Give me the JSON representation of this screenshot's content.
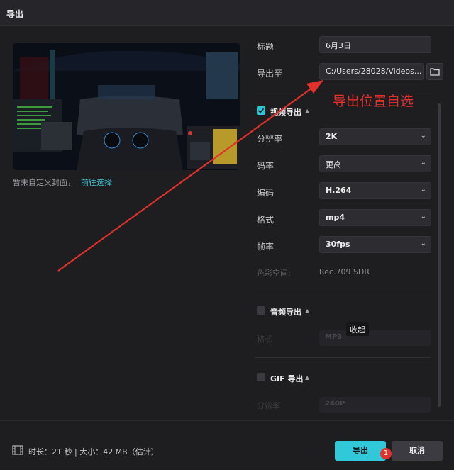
{
  "window": {
    "title": "导出"
  },
  "cover": {
    "note": "暂未自定义封面，",
    "link": "前往选择"
  },
  "fields": {
    "title_label": "标题",
    "title_value": "6月3日",
    "export_to_label": "导出至",
    "export_to_value": "C:/Users/28028/Videos..."
  },
  "video": {
    "section_title": "视频导出",
    "checked": true,
    "resolution_label": "分辨率",
    "resolution_value": "2K",
    "bitrate_label": "码率",
    "bitrate_value": "更高",
    "codec_label": "编码",
    "codec_value": "H.264",
    "format_label": "格式",
    "format_value": "mp4",
    "fps_label": "帧率",
    "fps_value": "30fps",
    "color_space_label": "色彩空间:",
    "color_space_value": "Rec.709 SDR"
  },
  "audio": {
    "section_title": "音频导出",
    "checked": false,
    "format_label": "格式",
    "format_value": "MP3"
  },
  "gif": {
    "section_title": "GIF 导出",
    "checked": false,
    "resolution_label": "分辨率",
    "resolution_value": "240P"
  },
  "tooltip": {
    "text": "收起"
  },
  "footer": {
    "info": "时长：21 秒 | 大小：42 MB（估计）",
    "export_button": "导出",
    "cancel_button": "取消",
    "badge": "1"
  },
  "annotation": {
    "text": "导出位置自选"
  },
  "colors": {
    "accent": "#31c9d9",
    "annotation_red": "#e2302b",
    "background": "#1e1e21"
  },
  "icons": [
    "folder-icon",
    "check-icon",
    "chevron-down-icon",
    "chevron-up-icon",
    "film-icon"
  ]
}
